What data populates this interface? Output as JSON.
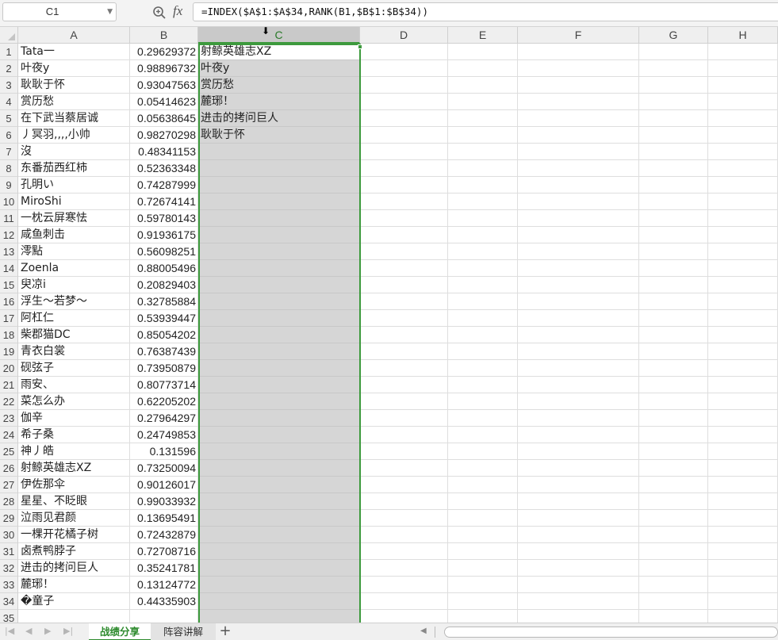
{
  "formula_bar": {
    "name_box": "C1",
    "fx_label": "fx",
    "formula": "=INDEX($A$1:$A$34,RANK(B1,$B$1:$B$34))",
    "zoom_icon": "magnifier-zoom-icon",
    "dropdown_icon": "chevron-down-icon"
  },
  "columns": [
    {
      "label": "A"
    },
    {
      "label": "B"
    },
    {
      "label": "C"
    },
    {
      "label": "D"
    },
    {
      "label": "E"
    },
    {
      "label": "F"
    },
    {
      "label": "G"
    },
    {
      "label": "H"
    }
  ],
  "selected_column": "C",
  "active_cell": "C1",
  "colors": {
    "selection_green": "#3d9a3d",
    "selected_column_fill": "#d6d6d6",
    "active_tab_text": "#2e8b2e"
  },
  "rows": [
    {
      "num": "1",
      "a": "Tata一",
      "b": "0.29629372",
      "c": "射鲸英雄志XZ"
    },
    {
      "num": "2",
      "a": "叶夜y",
      "b": "0.98896732",
      "c": "叶夜y"
    },
    {
      "num": "3",
      "a": "耿耿于怀",
      "b": "0.93047563",
      "c": "赏历愁"
    },
    {
      "num": "4",
      "a": "赏历愁",
      "b": "0.05414623",
      "c": "麓琊！"
    },
    {
      "num": "5",
      "a": "在下武当蔡居诚",
      "b": "0.05638645",
      "c": "进击的拷问巨人"
    },
    {
      "num": "6",
      "a": "丿冥羽,,,,小帅",
      "b": "0.98270298",
      "c": "耿耿于怀"
    },
    {
      "num": "7",
      "a": "沒",
      "b": "0.48341153",
      "c": ""
    },
    {
      "num": "8",
      "a": "东番茄西红柿",
      "b": "0.52363348",
      "c": ""
    },
    {
      "num": "9",
      "a": "孔明い",
      "b": "0.74287999",
      "c": ""
    },
    {
      "num": "10",
      "a": "MiroShi",
      "b": "0.72674141",
      "c": ""
    },
    {
      "num": "11",
      "a": "一枕云屏寒怯",
      "b": "0.59780143",
      "c": ""
    },
    {
      "num": "12",
      "a": "咸鱼刺击",
      "b": "0.91936175",
      "c": ""
    },
    {
      "num": "13",
      "a": "澪點",
      "b": "0.56098251",
      "c": ""
    },
    {
      "num": "14",
      "a": "Zoenla",
      "b": "0.88005496",
      "c": ""
    },
    {
      "num": "15",
      "a": "臾凉i",
      "b": "0.20829403",
      "c": ""
    },
    {
      "num": "16",
      "a": "浮生～若梦～",
      "b": "0.32785884",
      "c": ""
    },
    {
      "num": "17",
      "a": "阿杠仁",
      "b": "0.53939447",
      "c": ""
    },
    {
      "num": "18",
      "a": "柴郡猫DC",
      "b": "0.85054202",
      "c": ""
    },
    {
      "num": "19",
      "a": "青衣白裳",
      "b": "0.76387439",
      "c": ""
    },
    {
      "num": "20",
      "a": "砚弦子",
      "b": "0.73950879",
      "c": ""
    },
    {
      "num": "21",
      "a": "雨安、",
      "b": "0.80773714",
      "c": ""
    },
    {
      "num": "22",
      "a": "菜怎么办",
      "b": "0.62205202",
      "c": ""
    },
    {
      "num": "23",
      "a": "伽辛",
      "b": "0.27964297",
      "c": ""
    },
    {
      "num": "24",
      "a": "希子桑",
      "b": "0.24749853",
      "c": ""
    },
    {
      "num": "25",
      "a": "神丿皓",
      "b": "0.131596",
      "c": ""
    },
    {
      "num": "26",
      "a": "射鲸英雄志XZ",
      "b": "0.73250094",
      "c": ""
    },
    {
      "num": "27",
      "a": "伊佐那伞",
      "b": "0.90126017",
      "c": ""
    },
    {
      "num": "28",
      "a": "星星、不眨眼",
      "b": "0.99033932",
      "c": ""
    },
    {
      "num": "29",
      "a": "泣雨见君颜",
      "b": "0.13695491",
      "c": ""
    },
    {
      "num": "30",
      "a": "一棵开花橘子树",
      "b": "0.72432879",
      "c": ""
    },
    {
      "num": "31",
      "a": "卤煮鸭脖子",
      "b": "0.72708716",
      "c": ""
    },
    {
      "num": "32",
      "a": "进击的拷问巨人",
      "b": "0.35241781",
      "c": ""
    },
    {
      "num": "33",
      "a": "麓琊！",
      "b": "0.13124772",
      "c": ""
    },
    {
      "num": "34",
      "a": "�童子",
      "b": "0.44335903",
      "c": ""
    },
    {
      "num": "35",
      "a": "",
      "b": "",
      "c": ""
    }
  ],
  "sheet_tabs": [
    {
      "label": "战绩分享",
      "active": true
    },
    {
      "label": "阵容讲解",
      "active": false
    }
  ],
  "add_sheet_label": "+",
  "nav_arrows": [
    "|<",
    "<",
    ">",
    ">|"
  ]
}
